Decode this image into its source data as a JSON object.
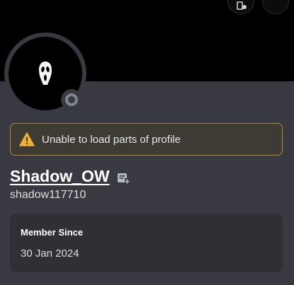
{
  "banner": {
    "color": "#000000"
  },
  "profile": {
    "avatar_icon": "ghostface-mask-icon",
    "status": "offline",
    "display_name": "Shadow_OW",
    "username": "shadow117710"
  },
  "warning": {
    "icon": "warning-triangle-icon",
    "text": "Unable to load parts of profile"
  },
  "member_since": {
    "heading": "Member Since",
    "date": "30 Jan 2024"
  },
  "colors": {
    "background": "#393a41",
    "card": "#2f3036",
    "warning_border": "#b5862c",
    "warning_icon": "#f0b232",
    "status_offline": "#80848e"
  }
}
